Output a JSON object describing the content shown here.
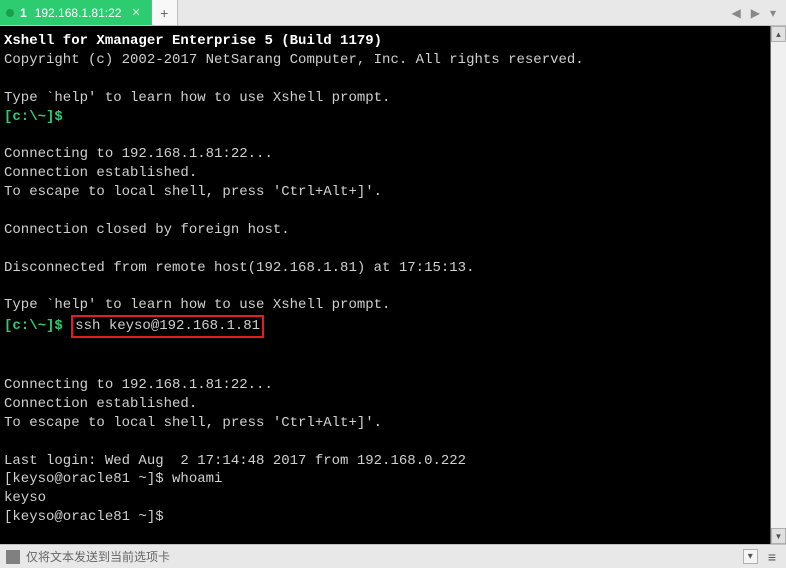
{
  "tab": {
    "number": "1",
    "title": "192.168.1.81:22"
  },
  "term": {
    "banner_title": "Xshell for Xmanager Enterprise 5 (Build 1179)",
    "copyright": "Copyright (c) 2002-2017 NetSarang Computer, Inc. All rights reserved.",
    "help_line": "Type `help' to learn how to use Xshell prompt.",
    "local_prompt": "[c:\\~]$",
    "connecting": "Connecting to 192.168.1.81:22...",
    "established": "Connection established.",
    "escape": "To escape to local shell, press 'Ctrl+Alt+]'.",
    "closed": "Connection closed by foreign host.",
    "disconnected": "Disconnected from remote host(192.168.1.81) at 17:15:13.",
    "ssh_cmd": "ssh keyso@192.168.1.81",
    "last_login": "Last login: Wed Aug  2 17:14:48 2017 from 192.168.0.222",
    "remote_prompt1": "[keyso@oracle81 ~]$ ",
    "whoami_cmd": "whoami",
    "whoami_out": "keyso",
    "remote_prompt2": "[keyso@oracle81 ~]$ "
  },
  "status": {
    "text": "仅将文本发送到当前选项卡"
  }
}
